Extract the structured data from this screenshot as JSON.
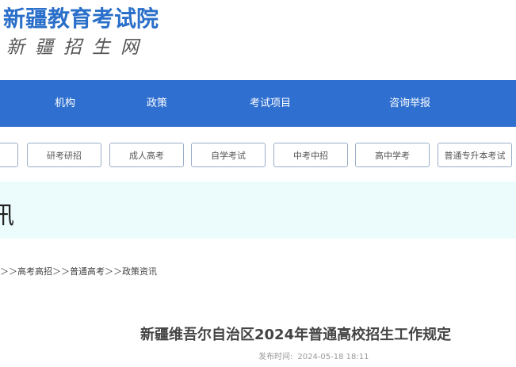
{
  "header": {
    "site_name": "新疆教育考试院",
    "site_subtitle": "新疆招生网"
  },
  "nav": {
    "items": [
      {
        "label": "机构"
      },
      {
        "label": "政策"
      },
      {
        "label": "考试项目"
      },
      {
        "label": "咨询举报"
      }
    ]
  },
  "categories": {
    "items": [
      {
        "label": "研考研招"
      },
      {
        "label": "成人高考"
      },
      {
        "label": "自学考试"
      },
      {
        "label": "中考中招"
      },
      {
        "label": "高中学考"
      },
      {
        "label": "普通专升本考试"
      }
    ]
  },
  "banner": {
    "text": "讯"
  },
  "breadcrumb": {
    "text": "＞＞高考高招＞＞普通高考＞＞政策资讯"
  },
  "article": {
    "title": "新疆维吾尔自治区2024年普通高校招生工作规定",
    "published_label": "发布时间:",
    "published_value": "2024-05-18 18:11"
  },
  "colors": {
    "nav_bg": "#2f6fd0",
    "brand_blue": "#2a6fc9",
    "banner_bg": "#ecfcfd"
  }
}
